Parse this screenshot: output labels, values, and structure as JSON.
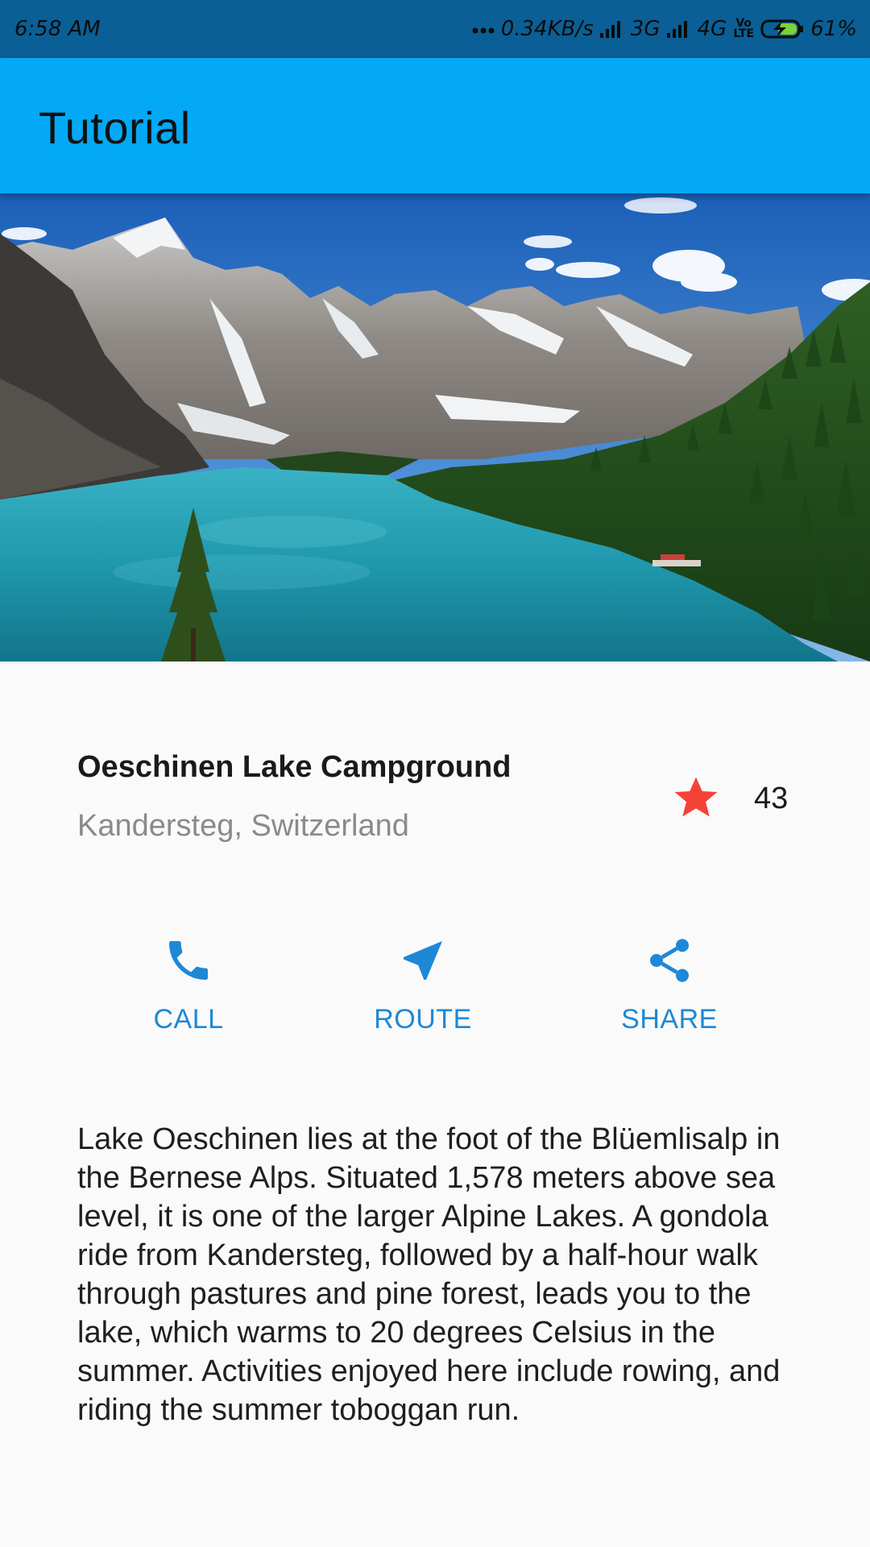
{
  "status_bar": {
    "time": "6:58 AM",
    "network_speed": "0.34KB/s",
    "signal_1_label": "3G",
    "signal_2_label": "4G",
    "volte_label": "Vo LTE",
    "battery_percent": "61%",
    "icons": [
      "dots-icon",
      "signal-icon",
      "signal-icon",
      "volte-icon",
      "battery-charging-icon"
    ]
  },
  "app_bar": {
    "title": "Tutorial",
    "color": "#03a9f4"
  },
  "place": {
    "name": "Oeschinen Lake Campground",
    "location": "Kandersteg, Switzerland",
    "rating_count": "43",
    "star_color": "#f44336"
  },
  "actions": [
    {
      "label": "CALL",
      "icon": "phone-icon"
    },
    {
      "label": "ROUTE",
      "icon": "navigation-icon"
    },
    {
      "label": "SHARE",
      "icon": "share-icon"
    }
  ],
  "accent_color": "#1e88d6",
  "description": "Lake Oeschinen lies at the foot of the Blüemlisalp in the Bernese Alps. Situated 1,578 meters above sea level, it is one of the larger Alpine Lakes. A gondola ride from Kandersteg, followed by a half-hour walk through pastures and pine forest, leads you to the lake, which warms to 20 degrees Celsius in the summer. Activities enjoyed here include rowing, and riding the summer toboggan run."
}
